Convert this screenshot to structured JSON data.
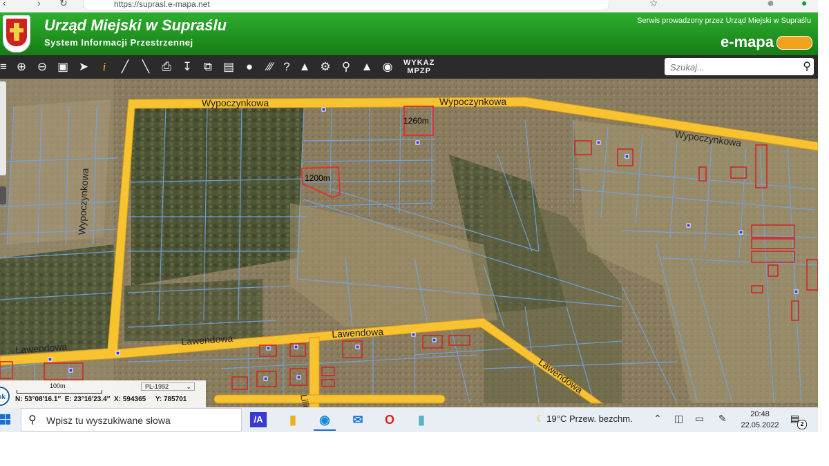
{
  "browser": {
    "url": "https://suprasl.e-mapa.net"
  },
  "header": {
    "title": "Urząd Miejski w Supraślu",
    "subtitle": "System Informacji Przestrzennej",
    "service": "Serwis prowadzony przez Urząd Miejski w Supraślu",
    "logo": "e-mapa"
  },
  "toolbar": {
    "icons": [
      "layers-icon",
      "zoom-in-icon",
      "zoom-out-icon",
      "zoom-extent-icon",
      "pointer-icon",
      "info-icon",
      "measure-line-icon",
      "measure-area-icon",
      "print-icon",
      "download-icon",
      "compare-icon",
      "layout-icon",
      "comment-icon",
      "hatch-icon",
      "help-icon",
      "scale-icon",
      "settings-icon",
      "location-pin-icon",
      "terrain-icon",
      "marker-icon"
    ],
    "wykaz_line1": "WYKAZ",
    "wykaz_line2": "MPZP",
    "search_placeholder": "Szukaj..."
  },
  "map": {
    "streets": [
      "Wypoczynkowa",
      "Wypoczynkowa",
      "Wypoczynkowa",
      "Wypoczynkowa",
      "Lawendowa",
      "Lawendowa",
      "Lawendowa",
      "Lawendowa",
      "Liliowa"
    ],
    "parcel_labels": [
      "1260m",
      "1200m"
    ],
    "colors": {
      "road": "#f7c331",
      "parcel_line": "#6ea6e8",
      "building": "#d42020",
      "aerial": "#8a7a5c"
    }
  },
  "scale": {
    "label": "100m",
    "projection": "PL-1992",
    "n": "N: 53°08′16.1″",
    "e": "E: 23°16′23.4″",
    "x": "X: 594365",
    "y": "Y: 785701"
  },
  "ok_label": "ok",
  "taskbar": {
    "search_placeholder": "Wpisz tu wyszukiwane słowa",
    "weather": "19°C  Przew. bezchm.",
    "time": "20:48",
    "date": "22.05.2022",
    "notifications": "2"
  }
}
